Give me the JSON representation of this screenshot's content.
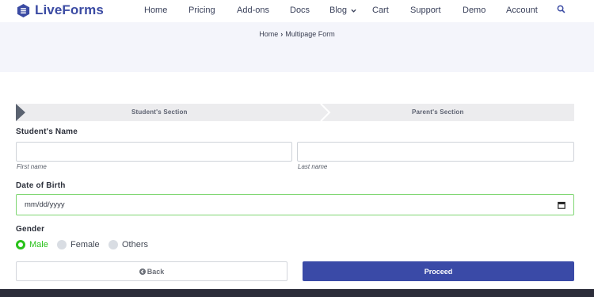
{
  "header": {
    "logo_text": "LiveForms",
    "nav": [
      "Home",
      "Pricing",
      "Add-ons",
      "Docs",
      "Blog",
      "Cart",
      "Support",
      "Demo",
      "Account"
    ]
  },
  "breadcrumb": {
    "home": "Home",
    "separator": "›",
    "current": "Multipage Form"
  },
  "steps": [
    {
      "label": "Student's Section",
      "active": true
    },
    {
      "label": "Parent's Section",
      "active": false
    }
  ],
  "form": {
    "student_name_label": "Student's Name",
    "first_name_hint": "First name",
    "last_name_hint": "Last name",
    "dob_label": "Date of Birth",
    "dob_placeholder": "mm/dd/yyyy",
    "gender_label": "Gender",
    "gender_options": [
      "Male",
      "Female",
      "Others"
    ],
    "gender_selected": "Male",
    "back_label": "Back",
    "proceed_label": "Proceed"
  },
  "colors": {
    "brand": "#3b4ba3",
    "proceed_button": "#3a4aa7",
    "selected_radio": "#29c21a",
    "focus_border": "#7fd672"
  }
}
